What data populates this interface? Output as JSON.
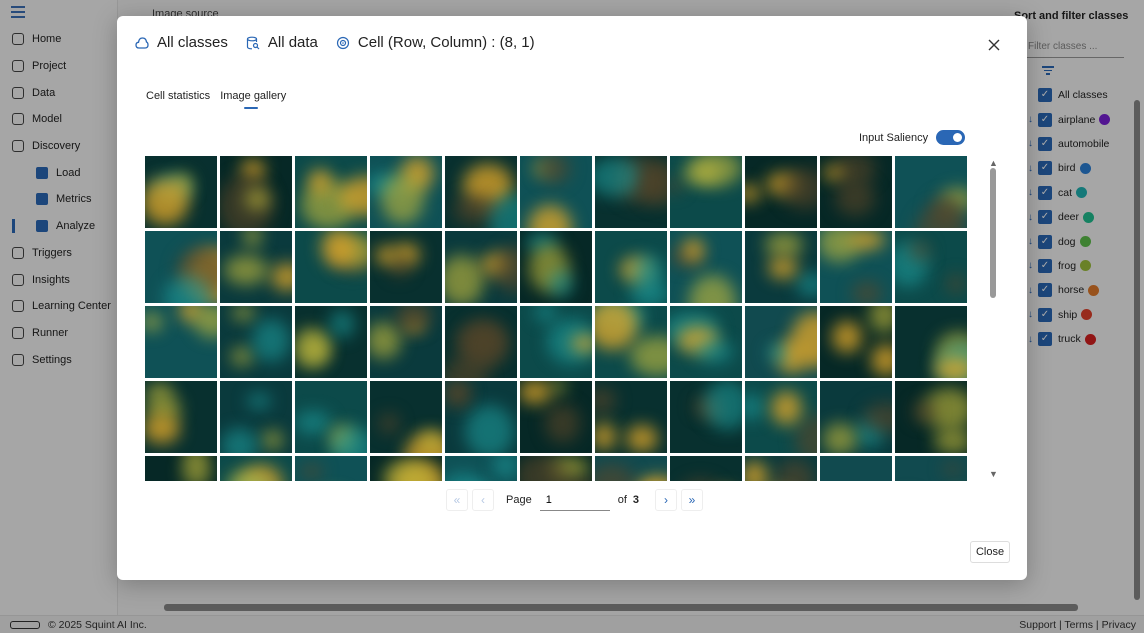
{
  "background": {
    "nav": [
      {
        "label": "Home",
        "icon": "home-icon"
      },
      {
        "label": "Project",
        "icon": "project-icon"
      },
      {
        "label": "Data",
        "icon": "data-icon"
      },
      {
        "label": "Model",
        "icon": "model-icon"
      },
      {
        "label": "Discovery",
        "icon": "discovery-icon"
      },
      {
        "label": "Load",
        "icon": "folder-icon",
        "sub": true
      },
      {
        "label": "Metrics",
        "icon": "gears-icon",
        "sub": true
      },
      {
        "label": "Analyze",
        "icon": "analyze-icon",
        "sub": true,
        "active": true
      },
      {
        "label": "Triggers",
        "icon": "triggers-icon"
      },
      {
        "label": "Insights",
        "icon": "insights-icon"
      },
      {
        "label": "Learning Center",
        "icon": "learning-icon"
      },
      {
        "label": "Runner",
        "icon": "runner-icon"
      },
      {
        "label": "Settings",
        "icon": "settings-icon"
      }
    ],
    "main_title": "Image source",
    "right_panel": {
      "title": "Sort and filter classes",
      "filter_placeholder": "Filter classes ...",
      "classes": [
        {
          "label": "All classes",
          "color": ""
        },
        {
          "label": "airplane",
          "color": "#7a1fd6"
        },
        {
          "label": "automobile",
          "color": ""
        },
        {
          "label": "bird",
          "color": "#2a7fd6"
        },
        {
          "label": "cat",
          "color": "#1fb3b3"
        },
        {
          "label": "deer",
          "color": "#1fbf8f"
        },
        {
          "label": "dog",
          "color": "#5cbf4a"
        },
        {
          "label": "frog",
          "color": "#9cbf3a"
        },
        {
          "label": "horse",
          "color": "#e07a2a"
        },
        {
          "label": "ship",
          "color": "#e0402a"
        },
        {
          "label": "truck",
          "color": "#d61f1f"
        }
      ]
    },
    "footer": {
      "copyright": "© 2025 Squint AI Inc.",
      "links": "Support | Terms | Privacy"
    }
  },
  "modal": {
    "crumbs": [
      {
        "label": "All classes",
        "icon": "cloud-icon"
      },
      {
        "label": "All data",
        "icon": "database-search-icon"
      },
      {
        "label": "Cell (Row, Column) : (8, 1)",
        "icon": "target-icon"
      }
    ],
    "tabs": [
      {
        "label": "Cell statistics",
        "active": false
      },
      {
        "label": "Image gallery",
        "active": true
      }
    ],
    "saliency_label": "Input Saliency",
    "saliency_on": true,
    "pager": {
      "page_label": "Page",
      "page_value": "1",
      "of_label": "of",
      "total_pages": "3"
    },
    "close_label": "Close"
  }
}
